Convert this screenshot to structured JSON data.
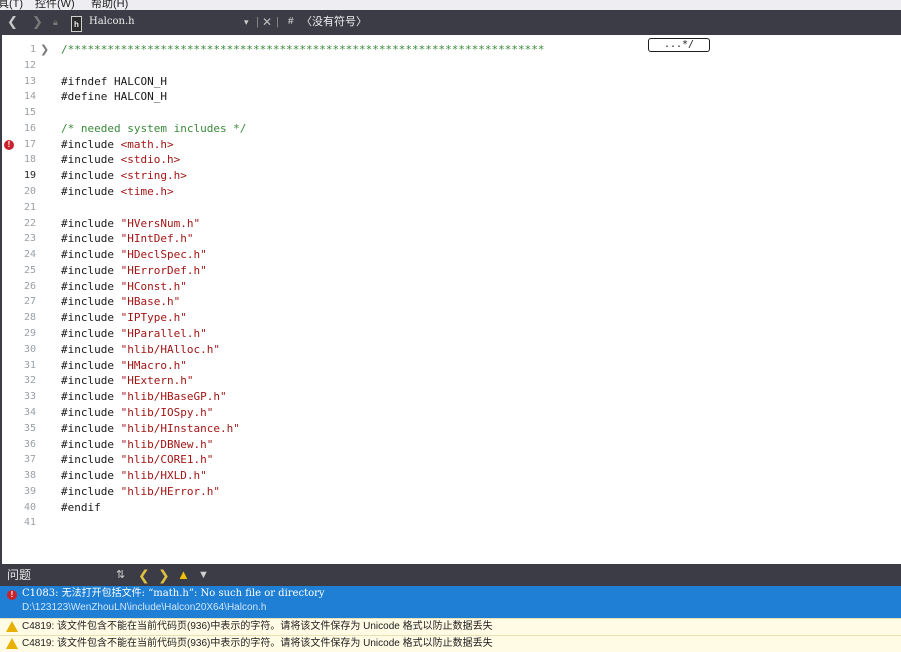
{
  "menubar": {
    "items": [
      "具(T)",
      "控件(W)",
      "帮助(H)"
    ]
  },
  "navbar": {
    "back": "❮",
    "forward": "❯",
    "file_icon_text": "h",
    "file_name": "Halcon.h",
    "dropdown_arrow": "▾",
    "separator": "|",
    "close": "✕",
    "hash": "#",
    "symbol_dropdown": "〈没有符号〉"
  },
  "editor": {
    "fold_marker": "❯",
    "collapse_text": "...*/",
    "lines": [
      {
        "n": "1",
        "text": "/************************************************************************"
      },
      {
        "n": "12",
        "text": ""
      },
      {
        "n": "13",
        "text": "#ifndef HALCON_H"
      },
      {
        "n": "14",
        "text": "#define HALCON_H"
      },
      {
        "n": "15",
        "text": ""
      },
      {
        "n": "16",
        "text": "/* needed system includes */"
      },
      {
        "n": "17",
        "text": "#include <math.h>"
      },
      {
        "n": "18",
        "text": "#include <stdio.h>"
      },
      {
        "n": "19",
        "text": "#include <string.h>"
      },
      {
        "n": "20",
        "text": "#include <time.h>"
      },
      {
        "n": "21",
        "text": ""
      },
      {
        "n": "22",
        "text": "#include \"HVersNum.h\""
      },
      {
        "n": "23",
        "text": "#include \"HIntDef.h\""
      },
      {
        "n": "24",
        "text": "#include \"HDeclSpec.h\""
      },
      {
        "n": "25",
        "text": "#include \"HErrorDef.h\""
      },
      {
        "n": "26",
        "text": "#include \"HConst.h\""
      },
      {
        "n": "27",
        "text": "#include \"HBase.h\""
      },
      {
        "n": "28",
        "text": "#include \"IPType.h\""
      },
      {
        "n": "29",
        "text": "#include \"HParallel.h\""
      },
      {
        "n": "30",
        "text": "#include \"hlib/HAlloc.h\""
      },
      {
        "n": "31",
        "text": "#include \"HMacro.h\""
      },
      {
        "n": "32",
        "text": "#include \"HExtern.h\""
      },
      {
        "n": "33",
        "text": "#include \"hlib/HBaseGP.h\""
      },
      {
        "n": "34",
        "text": "#include \"hlib/IOSpy.h\""
      },
      {
        "n": "35",
        "text": "#include \"hlib/HInstance.h\""
      },
      {
        "n": "36",
        "text": "#include \"hlib/DBNew.h\""
      },
      {
        "n": "37",
        "text": "#include \"hlib/CORE1.h\""
      },
      {
        "n": "38",
        "text": "#include \"hlib/HXLD.h\""
      },
      {
        "n": "39",
        "text": "#include \"hlib/HError.h\""
      },
      {
        "n": "40",
        "text": "#endif"
      },
      {
        "n": "41",
        "text": ""
      }
    ]
  },
  "problems": {
    "title": "问题",
    "error": {
      "code": "C1083: 无法打开包括文件: “math.h”: No such file or directory",
      "path": "D:\\123123\\WenZhouLN\\include\\Halcon20X64\\Halcon.h"
    },
    "warnings": [
      "C4819: 该文件包含不能在当前代码页(936)中表示的字符。请将该文件保存为 Unicode 格式以防止数据丢失",
      "C4819: 该文件包含不能在当前代码页(936)中表示的字符。请将该文件保存为 Unicode 格式以防止数据丢失"
    ]
  },
  "colors": {
    "accent": "#1e7fd4",
    "toolbar": "#3c3c46",
    "warning": "#e8b000",
    "error": "#c8232c"
  }
}
